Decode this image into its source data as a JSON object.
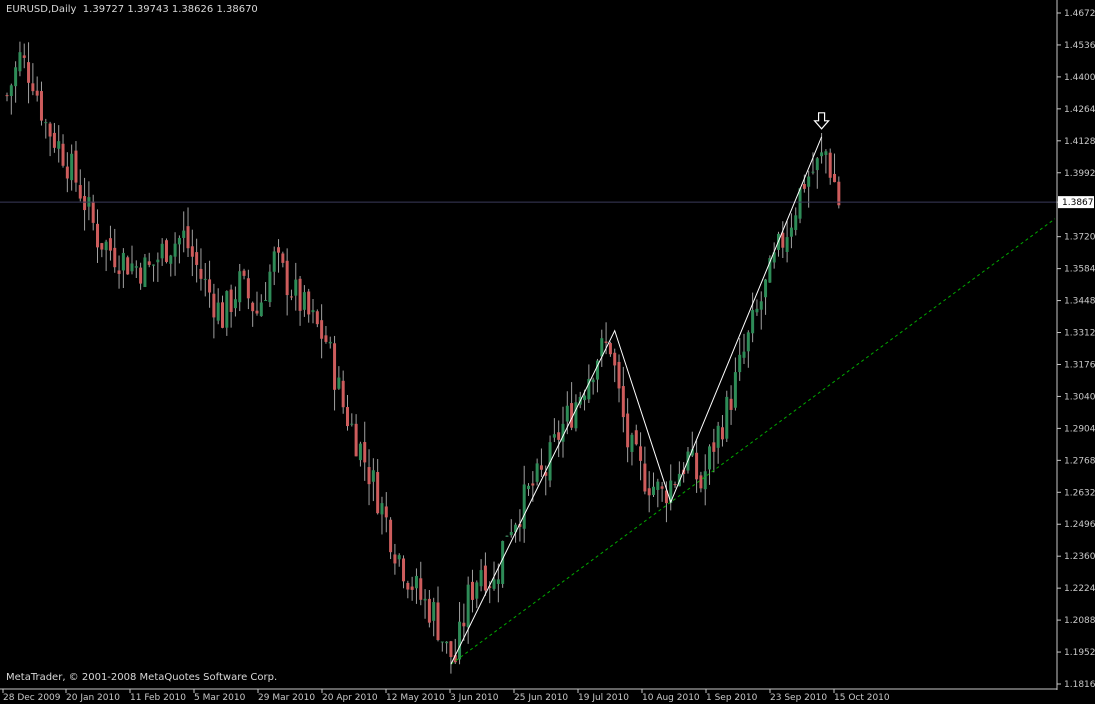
{
  "header": {
    "symbol": "EURUSD,Daily",
    "open": "1.39727",
    "high": "1.39743",
    "low": "1.38626",
    "close": "1.38670"
  },
  "copyright": "MetaTrader, © 2001-2008 MetaQuotes Software Corp.",
  "colors": {
    "background": "#000000",
    "bull": "#2e8b57",
    "bear": "#cd5c5c",
    "wick": "#a0a0a0",
    "grid": "#2a2a3a",
    "axis_text": "#c8c8c8",
    "trendline": "#00aa00",
    "zigzag": "#ffffff",
    "price_label_bg": "#ffffff"
  },
  "chart_data": {
    "type": "candlestick",
    "symbol": "EURUSD",
    "timeframe": "Daily",
    "y_ticks": [
      "1.46720",
      "1.45360",
      "1.44000",
      "1.42640",
      "1.41280",
      "1.39920",
      "1.38670",
      "1.37200",
      "1.35840",
      "1.34480",
      "1.33120",
      "1.31760",
      "1.30400",
      "1.29040",
      "1.27680",
      "1.26320",
      "1.24960",
      "1.23600",
      "1.22240",
      "1.20880",
      "1.19520",
      "1.18160"
    ],
    "ylim": [
      1.1816,
      1.4672
    ],
    "current_price": "1.38670",
    "x_ticks": [
      "28 Dec 2009",
      "20 Jan 2010",
      "11 Feb 2010",
      "5 Mar 2010",
      "29 Mar 2010",
      "20 Apr 2010",
      "12 May 2010",
      "3 Jun 2010",
      "25 Jun 2010",
      "19 Jul 2010",
      "10 Aug 2010",
      "1 Sep 2010",
      "23 Sep 2010",
      "15 Oct 2010"
    ],
    "close_path": [
      [
        0,
        1.432
      ],
      [
        3,
        1.448
      ],
      [
        6,
        1.44
      ],
      [
        9,
        1.42
      ],
      [
        13,
        1.408
      ],
      [
        17,
        1.392
      ],
      [
        21,
        1.372
      ],
      [
        25,
        1.365
      ],
      [
        29,
        1.36
      ],
      [
        33,
        1.358
      ],
      [
        37,
        1.368
      ],
      [
        41,
        1.372
      ],
      [
        45,
        1.355
      ],
      [
        50,
        1.338
      ],
      [
        54,
        1.352
      ],
      [
        58,
        1.34
      ],
      [
        62,
        1.362
      ],
      [
        66,
        1.35
      ],
      [
        70,
        1.338
      ],
      [
        74,
        1.328
      ],
      [
        78,
        1.3
      ],
      [
        82,
        1.282
      ],
      [
        86,
        1.262
      ],
      [
        90,
        1.24
      ],
      [
        93,
        1.228
      ],
      [
        96,
        1.218
      ],
      [
        99,
        1.212
      ],
      [
        102,
        1.196
      ],
      [
        104,
        1.192
      ],
      [
        107,
        1.218
      ],
      [
        110,
        1.232
      ],
      [
        113,
        1.224
      ],
      [
        116,
        1.248
      ],
      [
        119,
        1.256
      ],
      [
        122,
        1.266
      ],
      [
        125,
        1.272
      ],
      [
        128,
        1.288
      ],
      [
        131,
        1.298
      ],
      [
        134,
        1.31
      ],
      [
        137,
        1.322
      ],
      [
        140,
        1.326
      ],
      [
        142,
        1.304
      ],
      [
        144,
        1.284
      ],
      [
        147,
        1.272
      ],
      [
        150,
        1.266
      ],
      [
        152,
        1.262
      ],
      [
        155,
        1.27
      ],
      [
        158,
        1.278
      ],
      [
        161,
        1.266
      ],
      [
        164,
        1.284
      ],
      [
        167,
        1.298
      ],
      [
        170,
        1.316
      ],
      [
        173,
        1.334
      ],
      [
        176,
        1.35
      ],
      [
        179,
        1.366
      ],
      [
        182,
        1.38
      ],
      [
        185,
        1.396
      ],
      [
        188,
        1.402
      ],
      [
        190,
        1.408
      ],
      [
        192,
        1.395
      ],
      [
        193,
        1.3867
      ]
    ],
    "zigzag": [
      [
        103,
        1.19
      ],
      [
        141,
        1.332
      ],
      [
        154,
        1.259
      ],
      [
        189,
        1.4145
      ]
    ],
    "trendline": [
      [
        103,
        1.19
      ],
      [
        154,
        1.259
      ]
    ],
    "arrow_marker": [
      189,
      1.4145
    ],
    "grid": false
  }
}
